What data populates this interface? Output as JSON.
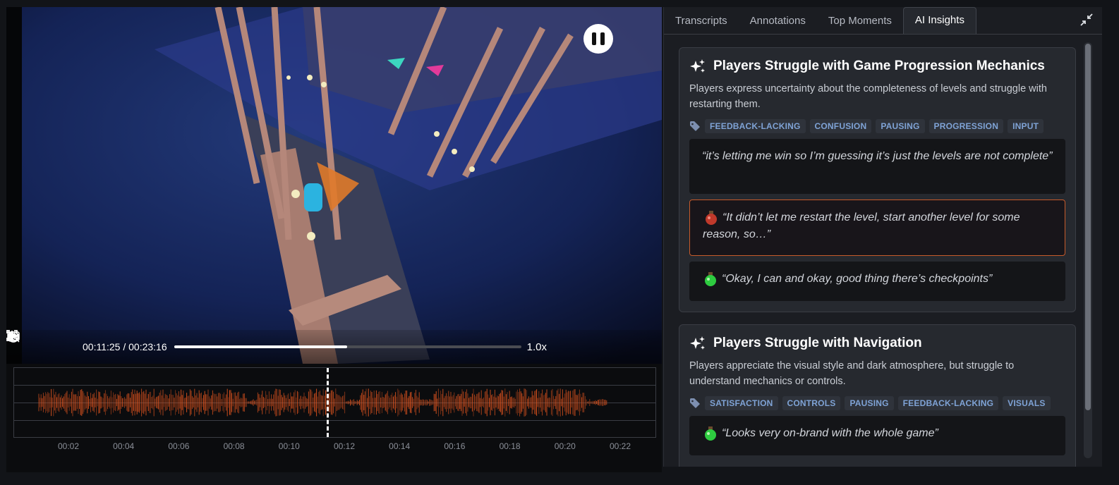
{
  "player": {
    "current_time": "00:11:25",
    "total_time": "00:23:16",
    "time_display": "00:11:25 / 00:23:16",
    "progress_fraction": 0.498,
    "speed": "1.0x",
    "state": "playing"
  },
  "timeline": {
    "tick_labels": [
      "00:02",
      "00:04",
      "00:06",
      "00:08",
      "00:10",
      "00:12",
      "00:14",
      "00:16",
      "00:18",
      "00:20",
      "00:22"
    ],
    "playhead_fraction": 0.488,
    "waveform_color": "#e0541f"
  },
  "tabs": [
    {
      "label": "Transcripts",
      "active": false
    },
    {
      "label": "Annotations",
      "active": false
    },
    {
      "label": "Top Moments",
      "active": false
    },
    {
      "label": "AI Insights",
      "active": true
    }
  ],
  "insights": [
    {
      "title": "Players Struggle with Game Progression Mechanics",
      "description": "Players express uncertainty about the completeness of levels and struggle with restarting them.",
      "tags": [
        "FEEDBACK-LACKING",
        "CONFUSION",
        "PAUSING",
        "PROGRESSION",
        "INPUT"
      ],
      "quotes": [
        {
          "text": "“it’s letting me win so I’m guessing it’s just the levels are not complete”",
          "sentiment": "none",
          "highlighted": false
        },
        {
          "text": "“It didn’t let me restart the level, start another level for some reason, so…”",
          "sentiment": "negative",
          "highlighted": true
        },
        {
          "text": "“Okay, I can and okay, good thing there’s checkpoints”",
          "sentiment": "positive",
          "highlighted": false
        }
      ]
    },
    {
      "title": "Players Struggle with Navigation",
      "description": "Players appreciate the visual style and dark atmosphere, but struggle to understand mechanics or controls.",
      "tags": [
        "SATISFACTION",
        "CONTROLS",
        "PAUSING",
        "FEEDBACK-LACKING",
        "VISUALS"
      ],
      "quotes": [
        {
          "text": "“Looks very on-brand with the whole game”",
          "sentiment": "positive",
          "highlighted": false
        }
      ]
    }
  ],
  "colors": {
    "accent_tag": "#7fa3d6",
    "highlight_border": "#c65a2a",
    "negative_potion": "#c0392b",
    "positive_potion": "#2ecc40"
  },
  "icons": [
    "replay-5-icon",
    "play-icon",
    "forward-5-icon",
    "volume-icon",
    "captions-off-icon",
    "fullscreen-icon",
    "download-icon",
    "wrench-icon",
    "pause-icon",
    "collapse-icon",
    "sparkle-icon",
    "tag-icon"
  ]
}
